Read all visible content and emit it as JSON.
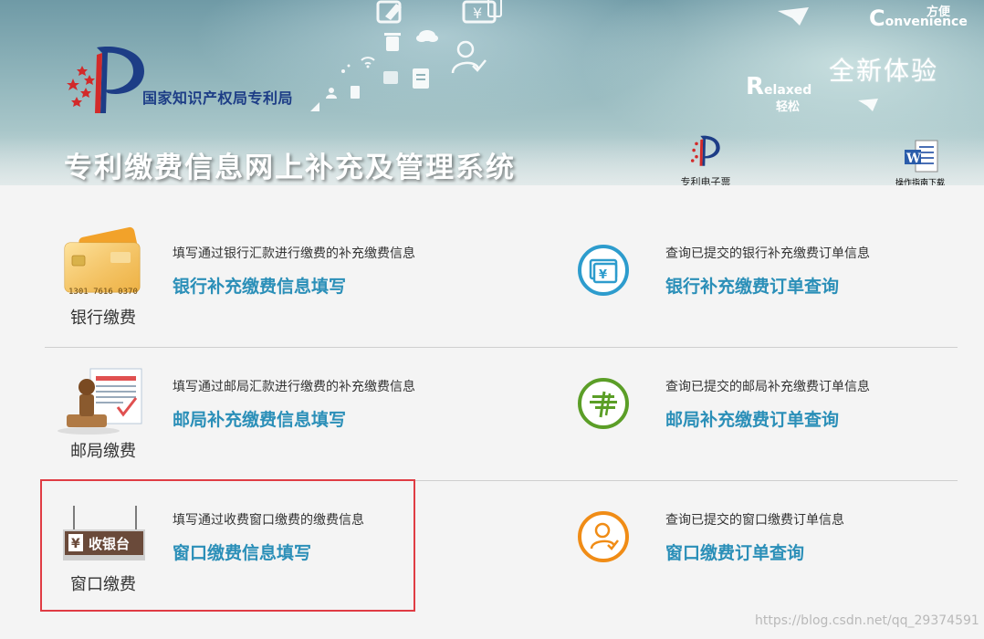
{
  "banner": {
    "logo_text": "国家知识产权局专利局",
    "title": "专利缴费信息网上补充及管理系统",
    "slogans": {
      "fangbian": "方便",
      "convenience_initial": "C",
      "convenience_rest": "onvenience",
      "new_experience": "全新体验",
      "relaxed_initial": "R",
      "relaxed_rest": "elaxed",
      "qingsong": "轻松"
    },
    "ebill_label": "专利电子票据系统",
    "guide_label": "操作指南下载"
  },
  "rows": [
    {
      "left": {
        "image_label": "银行缴费",
        "desc": "填写通过银行汇款进行缴费的补充缴费信息",
        "link": "银行补充缴费信息填写"
      },
      "right": {
        "icon": "bank-card-icon",
        "color": "#2d9ccd",
        "desc": "查询已提交的银行补充缴费订单信息",
        "link": "银行补充缴费订单查询"
      }
    },
    {
      "left": {
        "image_label": "邮局缴费",
        "desc": "填写通过邮局汇款进行缴费的补充缴费信息",
        "link": "邮局补充缴费信息填写"
      },
      "right": {
        "icon": "post-office-icon",
        "color": "#5b9e27",
        "desc": "查询已提交的邮局补充缴费订单信息",
        "link": "邮局补充缴费订单查询"
      }
    },
    {
      "left": {
        "image_label": "窗口缴费",
        "sign_text": "收银台",
        "sign_symbol": "¥",
        "desc": "填写通过收费窗口缴费的缴费信息",
        "link": "窗口缴费信息填写"
      },
      "right": {
        "icon": "person-check-icon",
        "color": "#f08c16",
        "desc": "查询已提交的窗口缴费订单信息",
        "link": "窗口缴费订单查询"
      }
    }
  ],
  "card_number": "1301 7616 0370",
  "watermark": "https://blog.csdn.net/qq_29374591",
  "colors": {
    "link": "#2b8fb8",
    "highlight_border": "#e03c44",
    "banner_title": "#ffffff"
  }
}
